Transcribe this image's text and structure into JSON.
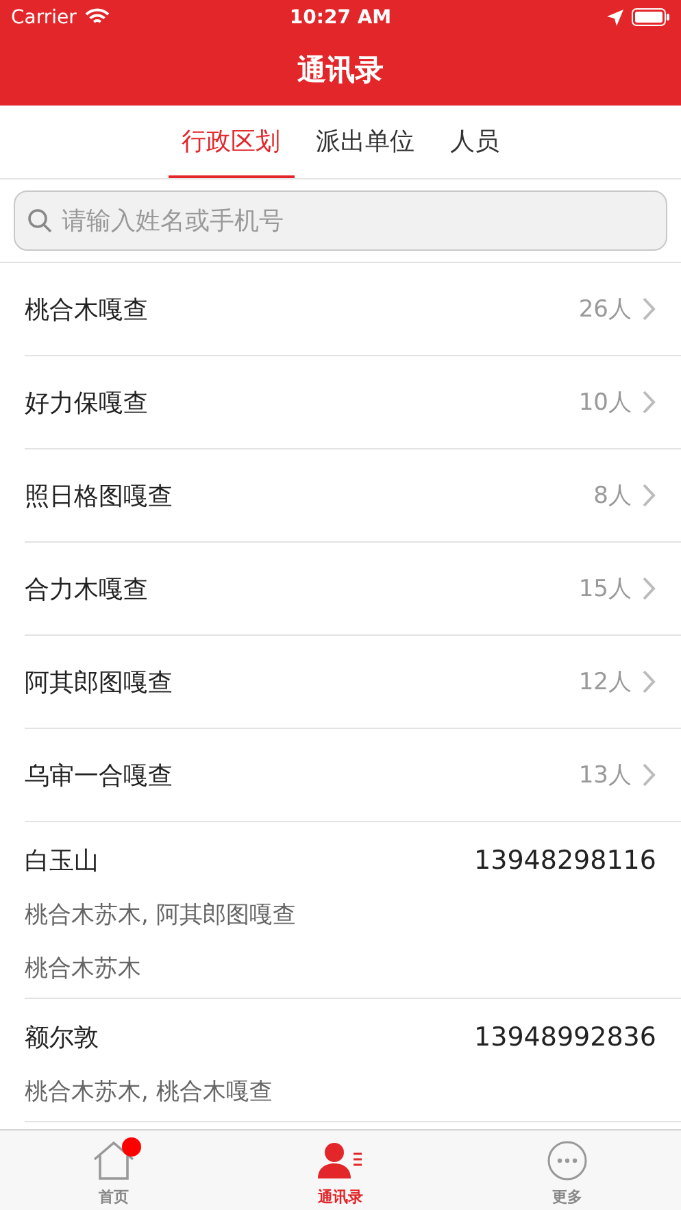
{
  "status_bar": {
    "carrier": "Carrier",
    "time": "10:27 AM"
  },
  "nav": {
    "title": "通讯录"
  },
  "tabs": [
    {
      "label": "行政区划",
      "selected": true
    },
    {
      "label": "派出单位",
      "selected": false
    },
    {
      "label": "人员",
      "selected": false
    }
  ],
  "search": {
    "placeholder": "请输入姓名或手机号"
  },
  "units": [
    {
      "name": "桃合木嘎查",
      "count": "26人"
    },
    {
      "name": "好力保嘎查",
      "count": "10人"
    },
    {
      "name": "照日格图嘎查",
      "count": "8人"
    },
    {
      "name": "合力木嘎查",
      "count": "15人"
    },
    {
      "name": "阿其郎图嘎查",
      "count": "12人"
    },
    {
      "name": "乌审一合嘎查",
      "count": "13人"
    }
  ],
  "people": [
    {
      "name": "白玉山",
      "phone": "13948298116",
      "lines": [
        "桃合木苏木, 阿其郎图嘎查",
        "桃合木苏木"
      ]
    },
    {
      "name": "额尔敦",
      "phone": "13948992836",
      "lines": [
        "桃合木苏木, 桃合木嘎查"
      ]
    }
  ],
  "tab_bar": [
    {
      "kind": "home",
      "label": "首页",
      "selected": false,
      "badge": true
    },
    {
      "kind": "contacts",
      "label": "通讯录",
      "selected": true,
      "badge": false
    },
    {
      "kind": "more",
      "label": "更多",
      "selected": false,
      "badge": false
    }
  ]
}
